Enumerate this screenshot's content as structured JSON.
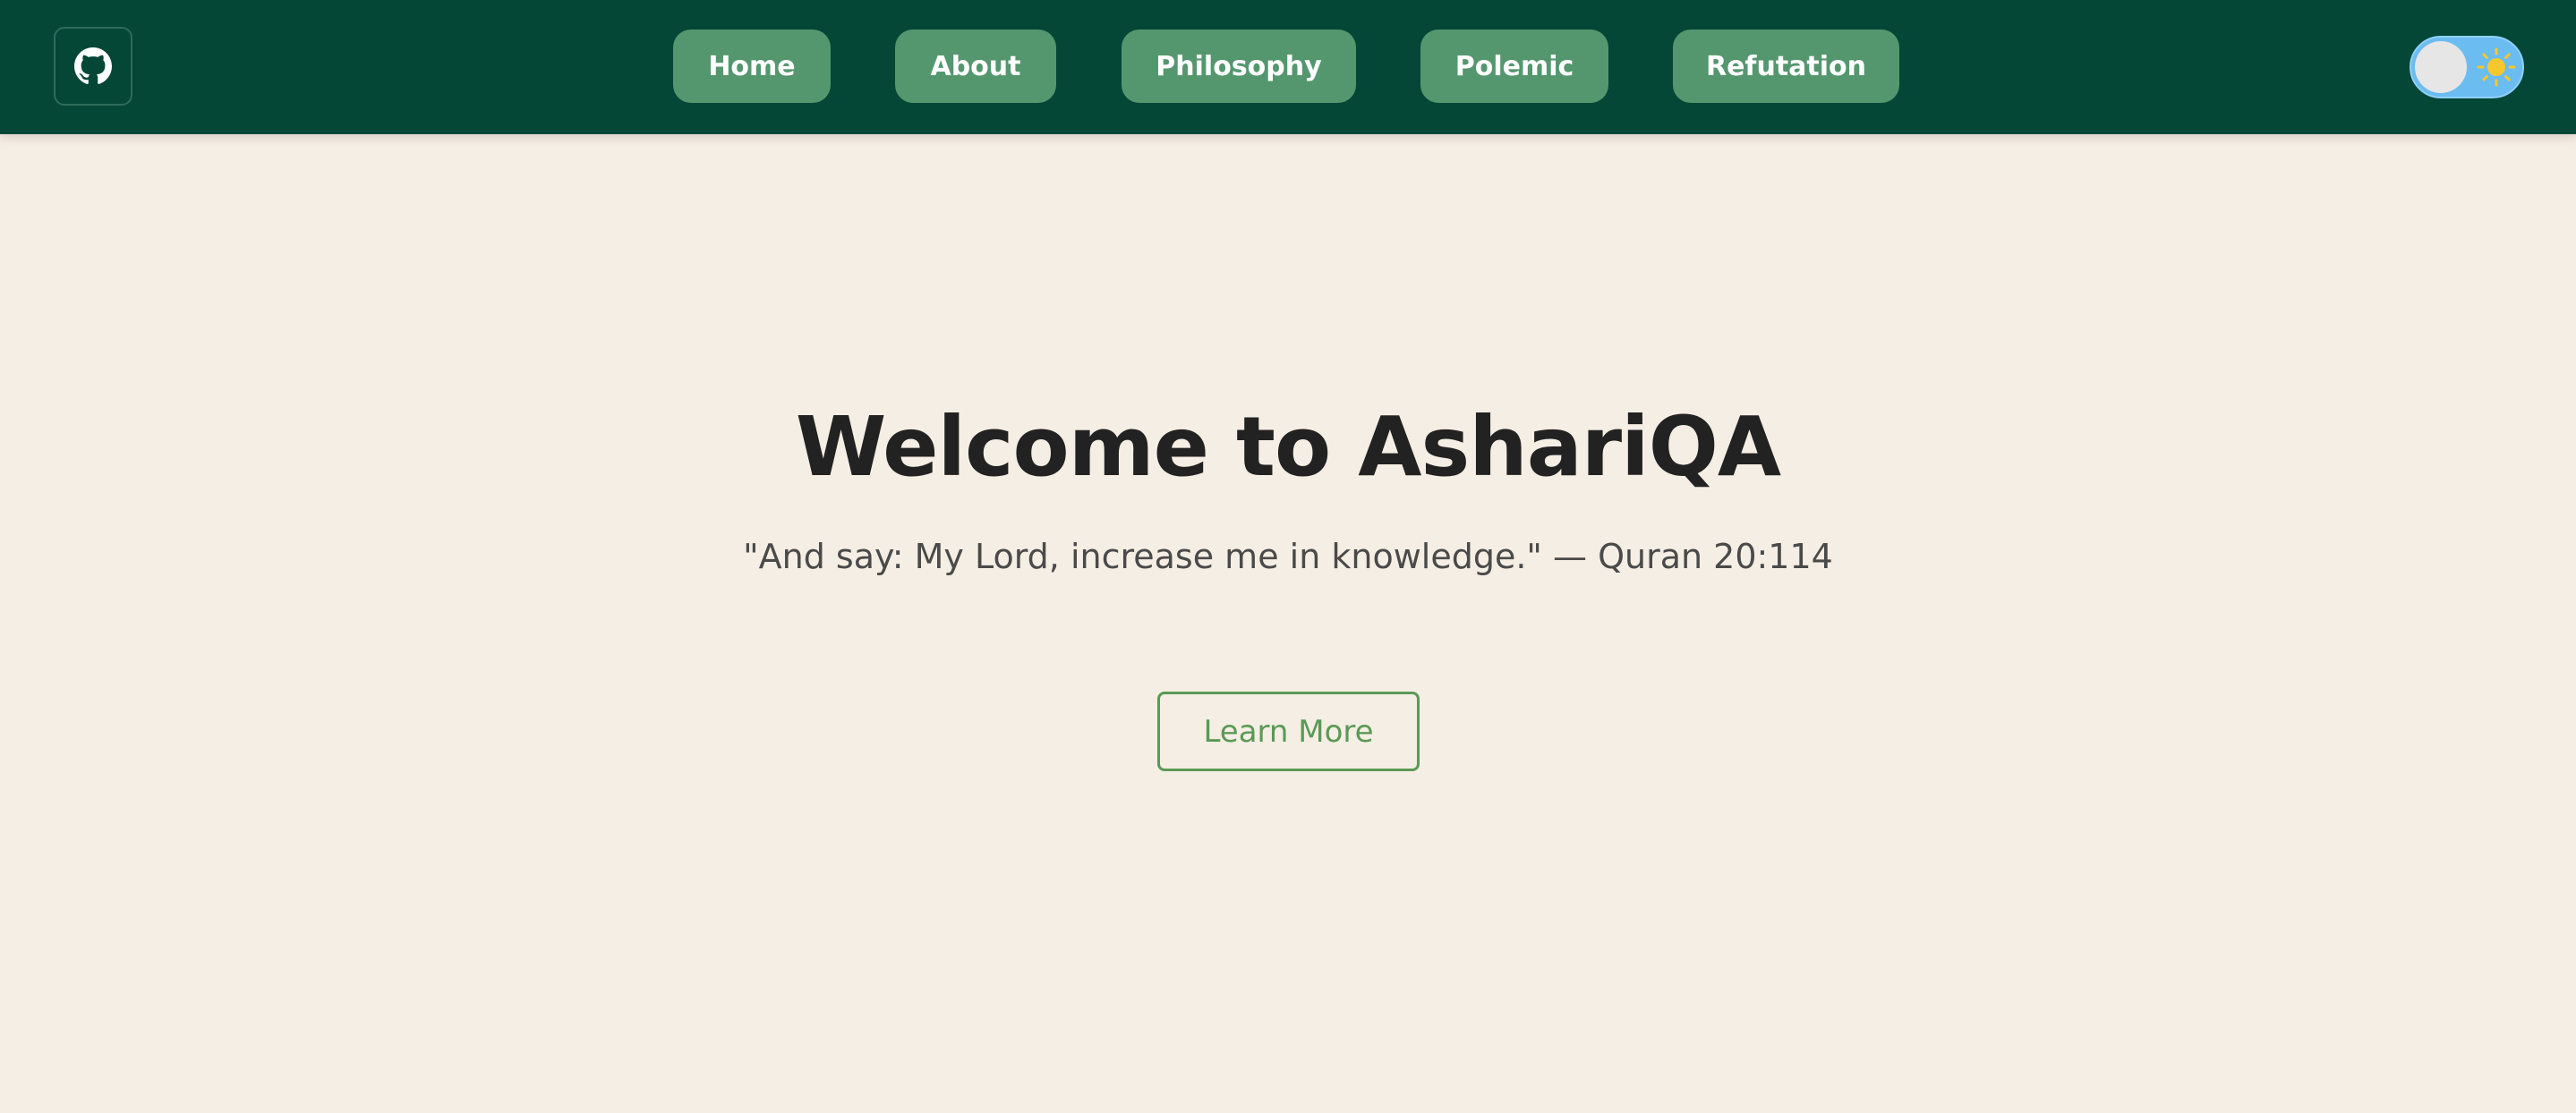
{
  "nav": {
    "github_icon": "github-icon",
    "links": [
      {
        "label": "Home"
      },
      {
        "label": "About"
      },
      {
        "label": "Philosophy"
      },
      {
        "label": "Polemic"
      },
      {
        "label": "Refutation"
      }
    ],
    "theme_toggle": {
      "state": "light",
      "icon": "sun-icon"
    }
  },
  "hero": {
    "title": "Welcome to AshariQA",
    "quote": "\"And say: My Lord, increase me in knowledge.\" — Quran 20:114",
    "button_label": "Learn More"
  },
  "colors": {
    "navbar": "#044736",
    "nav_button": "#54976f",
    "background": "#f5eee4",
    "accent": "#5a9a55",
    "toggle_track": "#6bbcf0",
    "sun": "#f7c72e"
  }
}
